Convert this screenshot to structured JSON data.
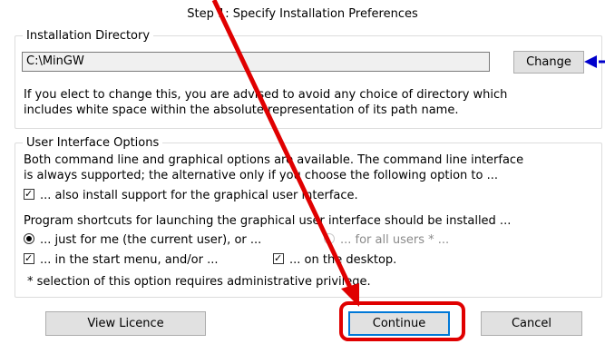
{
  "title": "Step 1: Specify Installation Preferences",
  "install_dir": {
    "legend": "Installation Directory",
    "path_value": "C:\\MinGW",
    "change_label": "Change",
    "note_line1": "If you elect to change this, you are advised to avoid any choice of directory which",
    "note_line2": "includes white space within the absolute representation of its path name."
  },
  "ui_options": {
    "legend": "User Interface Options",
    "desc_line1": "Both command line and graphical options are available.  The command line interface",
    "desc_line2": "is always supported; the alternative only if you choose the following option to ...",
    "gui_support": "... also install support for the graphical user interface.",
    "shortcuts_intro": "Program shortcuts for launching the graphical user interface should be installed ...",
    "radio_me": "... just for me (the current user), or ...",
    "radio_all": "... for all users * ...",
    "check_start_menu": "... in the start menu, and/or ...",
    "check_desktop": "... on the desktop.",
    "footnote": "*  selection of this option requires administrative privilege."
  },
  "buttons": {
    "view_licence": "View Licence",
    "continue": "Continue",
    "cancel": "Cancel"
  },
  "colors": {
    "annotation_red": "#e00000",
    "annotation_blue": "#0000cc",
    "focus_blue": "#0078d7"
  }
}
